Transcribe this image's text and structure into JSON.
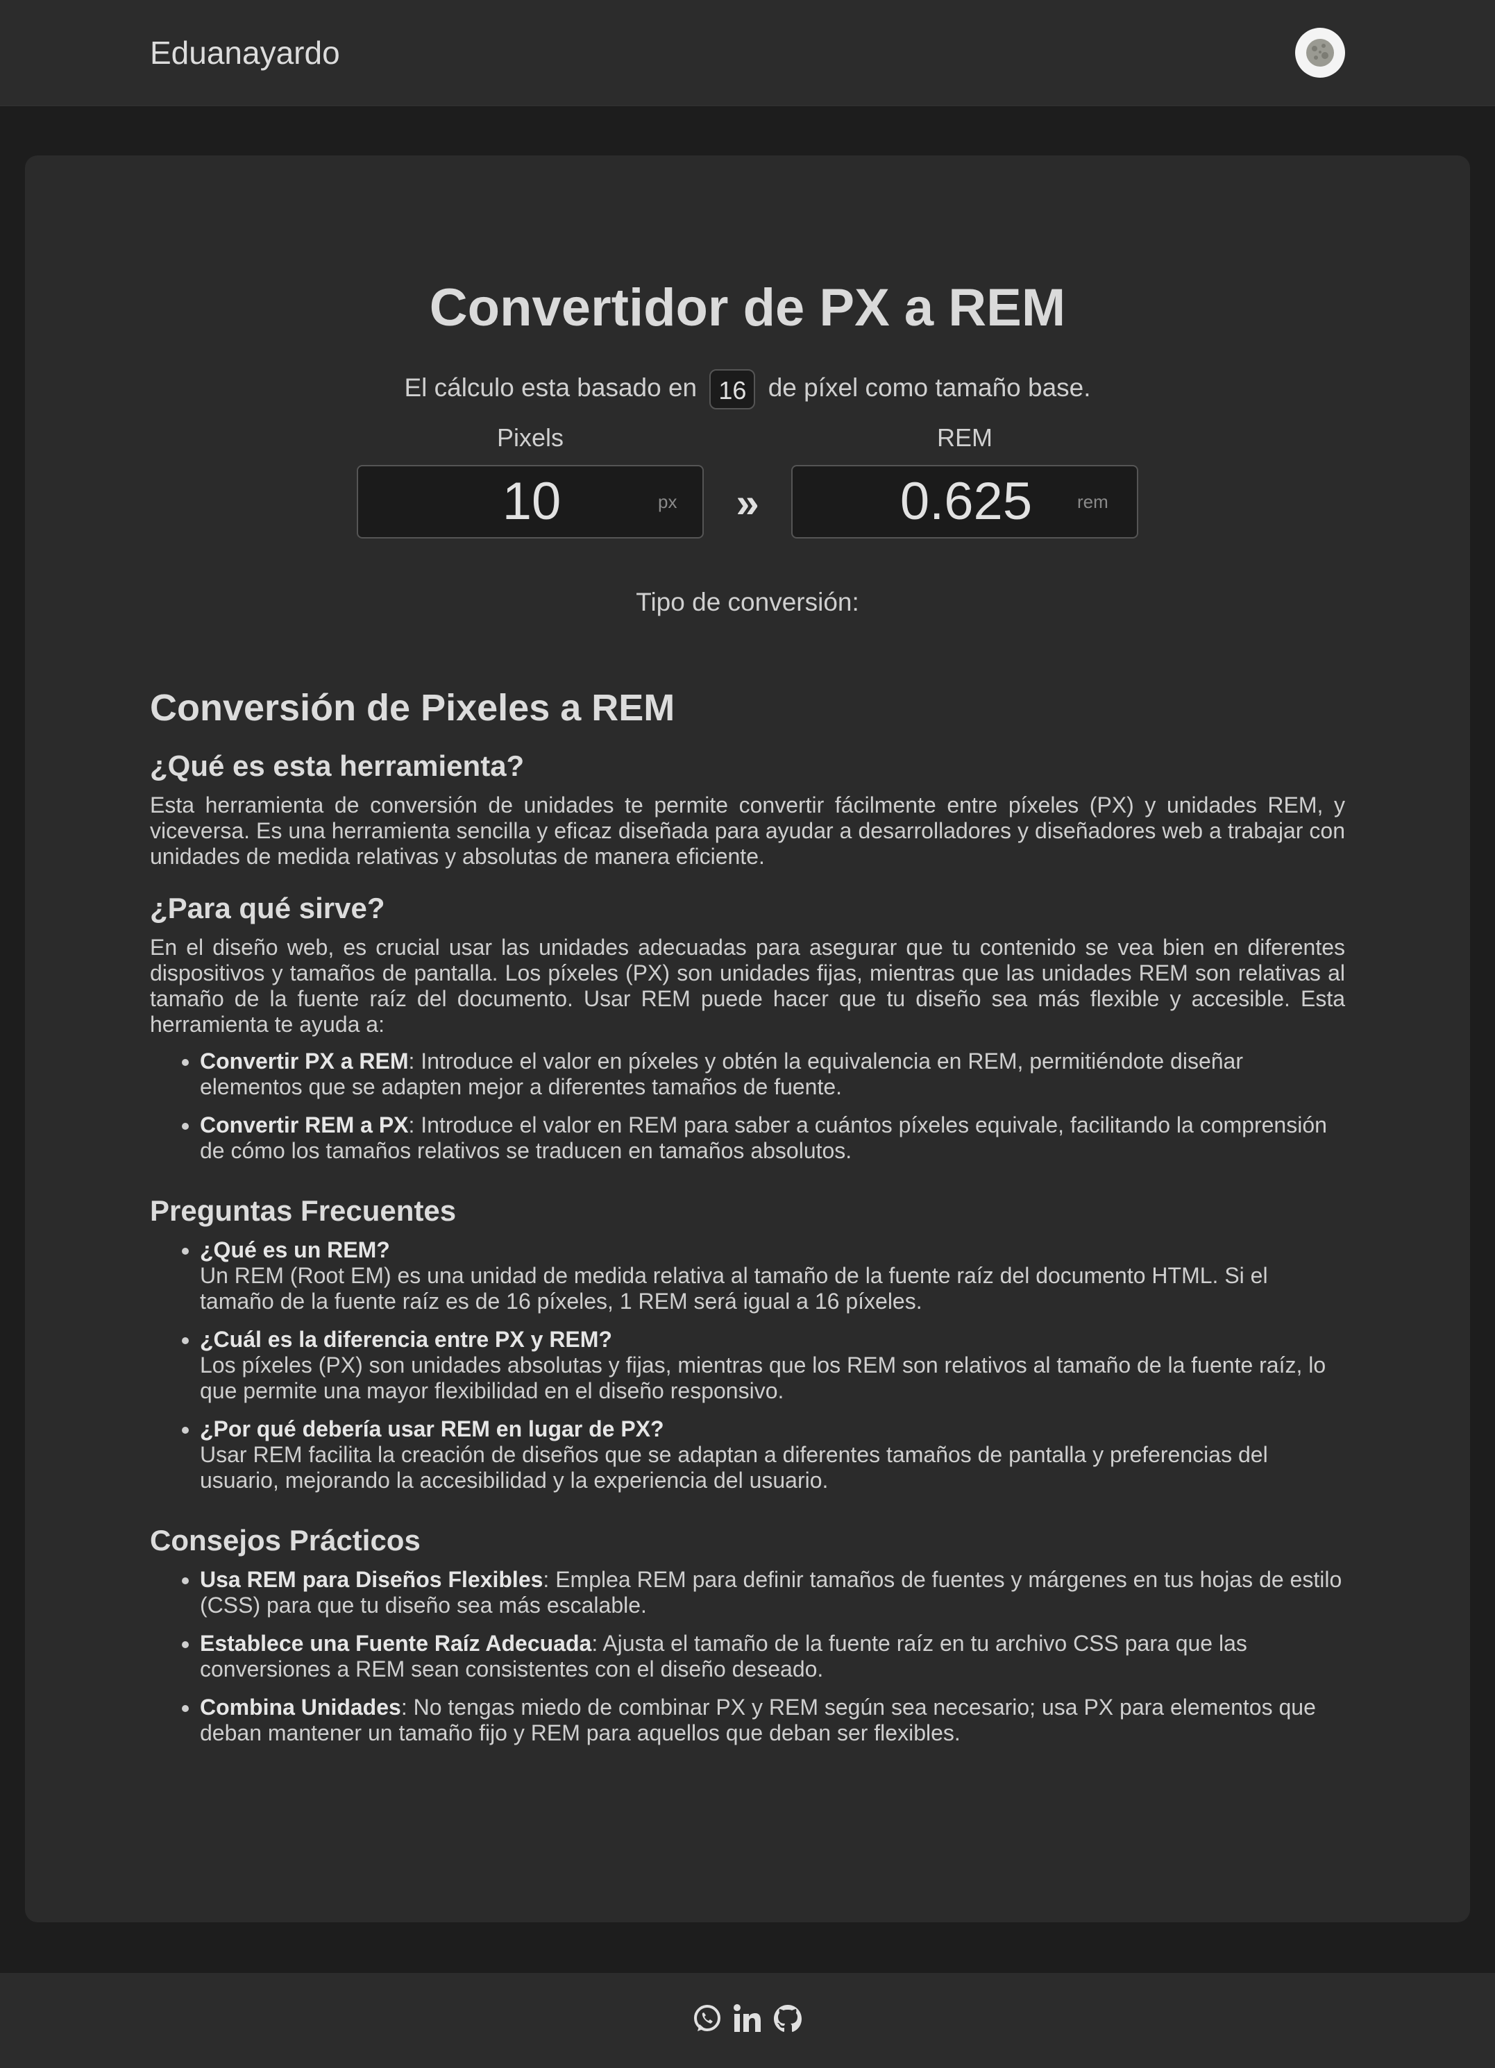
{
  "header": {
    "brand": "Eduanayardo"
  },
  "converter": {
    "title": "Convertidor de PX a REM",
    "base_prefix": "El cálculo esta basado en",
    "base_value": "16",
    "base_suffix": "de píxel como tamaño base.",
    "pixels_label": "Pixels",
    "rem_label": "REM",
    "px_value": "10",
    "px_unit": "px",
    "arrow": "»",
    "rem_value": "0.625",
    "rem_unit": "rem",
    "conversion_type_label": "Tipo de conversión:"
  },
  "article": {
    "title": "Conversión de Pixeles a REM",
    "what_heading": "¿Qué es esta herramienta?",
    "what_text": "Esta herramienta de conversión de unidades te permite convertir fácilmente entre píxeles (PX) y unidades REM, y viceversa. Es una herramienta sencilla y eficaz diseñada para ayudar a desarrolladores y diseñadores web a trabajar con unidades de medida relativas y absolutas de manera eficiente.",
    "purpose_heading": "¿Para qué sirve?",
    "purpose_text": "En el diseño web, es crucial usar las unidades adecuadas para asegurar que tu contenido se vea bien en diferentes dispositivos y tamaños de pantalla. Los píxeles (PX) son unidades fijas, mientras que las unidades REM son relativas al tamaño de la fuente raíz del documento. Usar REM puede hacer que tu diseño sea más flexible y accesible. Esta herramienta te ayuda a:",
    "purpose_items": [
      {
        "bold": "Convertir PX a REM",
        "text": ": Introduce el valor en píxeles y obtén la equivalencia en REM, permitiéndote diseñar elementos que se adapten mejor a diferentes tamaños de fuente."
      },
      {
        "bold": "Convertir REM a PX",
        "text": ": Introduce el valor en REM para saber a cuántos píxeles equivale, facilitando la comprensión de cómo los tamaños relativos se traducen en tamaños absolutos."
      }
    ],
    "faq_heading": "Preguntas Frecuentes",
    "faq_items": [
      {
        "question": "¿Qué es un REM?",
        "answer": "Un REM (Root EM) es una unidad de medida relativa al tamaño de la fuente raíz del documento HTML. Si el tamaño de la fuente raíz es de 16 píxeles, 1 REM será igual a 16 píxeles."
      },
      {
        "question": "¿Cuál es la diferencia entre PX y REM?",
        "answer": "Los píxeles (PX) son unidades absolutas y fijas, mientras que los REM son relativos al tamaño de la fuente raíz, lo que permite una mayor flexibilidad en el diseño responsivo."
      },
      {
        "question": "¿Por qué debería usar REM en lugar de PX?",
        "answer": "Usar REM facilita la creación de diseños que se adaptan a diferentes tamaños de pantalla y preferencias del usuario, mejorando la accesibilidad y la experiencia del usuario."
      }
    ],
    "tips_heading": "Consejos Prácticos",
    "tips_items": [
      {
        "bold": "Usa REM para Diseños Flexibles",
        "text": ": Emplea REM para definir tamaños de fuentes y márgenes en tus hojas de estilo (CSS) para que tu diseño sea más escalable."
      },
      {
        "bold": "Establece una Fuente Raíz Adecuada",
        "text": ": Ajusta el tamaño de la fuente raíz en tu archivo CSS para que las conversiones a REM sean consistentes con el diseño deseado."
      },
      {
        "bold": "Combina Unidades",
        "text": ": No tengas miedo de combinar PX y REM según sea necesario; usa PX para elementos que deban mantener un tamaño fijo y REM para aquellos que deban ser flexibles."
      }
    ]
  },
  "footer": {
    "icons": [
      "whatsapp-icon",
      "linkedin-icon",
      "github-icon"
    ]
  }
}
